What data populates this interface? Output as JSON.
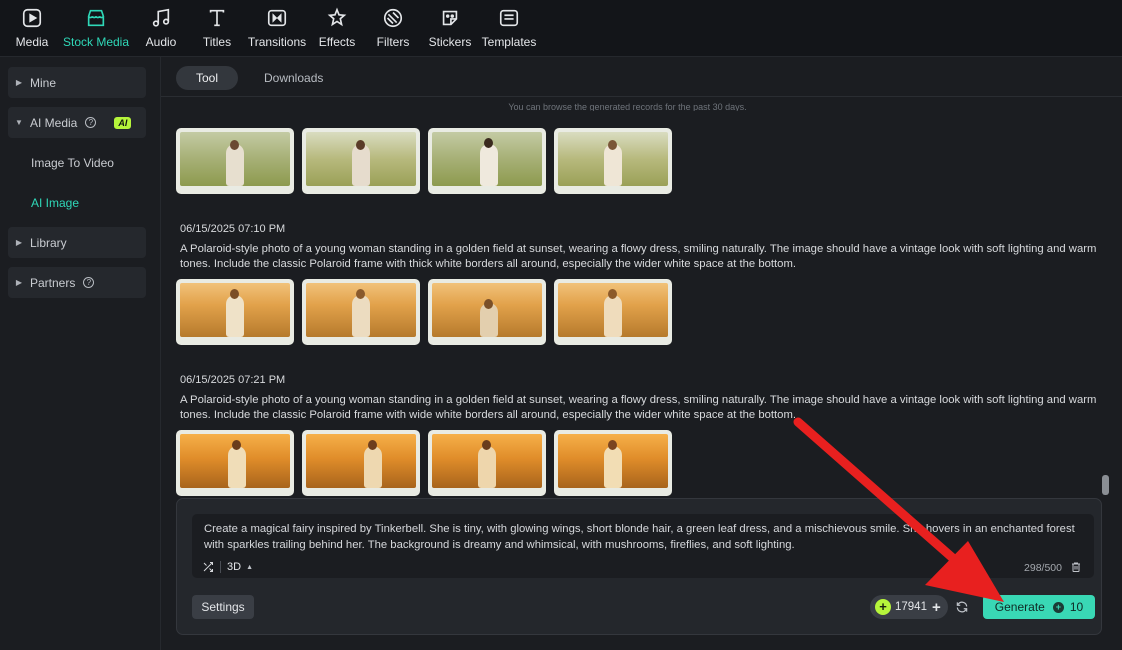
{
  "toolbar": {
    "items": [
      {
        "label": "Media",
        "icon": "media-icon"
      },
      {
        "label": "Stock Media",
        "icon": "stock-media-icon",
        "active": true
      },
      {
        "label": "Audio",
        "icon": "music-note-icon"
      },
      {
        "label": "Titles",
        "icon": "text-t-icon"
      },
      {
        "label": "Transitions",
        "icon": "transition-icon"
      },
      {
        "label": "Effects",
        "icon": "sparkle-icon"
      },
      {
        "label": "Filters",
        "icon": "filter-icon"
      },
      {
        "label": "Stickers",
        "icon": "sticker-icon"
      },
      {
        "label": "Templates",
        "icon": "template-icon"
      }
    ]
  },
  "sidebar": {
    "mine": "Mine",
    "ai_media": "AI Media",
    "ai_badge": "AI",
    "image_to_video": "Image To Video",
    "ai_image": "AI Image",
    "library": "Library",
    "partners": "Partners"
  },
  "tabs": {
    "tool": "Tool",
    "downloads": "Downloads"
  },
  "note": "You can browse the generated records for the past 30 days.",
  "records": [
    {
      "date": "06/15/2025 07:10 PM",
      "prompt": "A Polaroid-style photo of a young woman standing in a golden field at sunset, wearing a flowy dress, smiling naturally. The image should have a vintage look with soft lighting and warm tones. Include the classic Polaroid frame with thick white borders all around, especially the wider white space at the bottom."
    },
    {
      "date": "06/15/2025 07:21 PM",
      "prompt": "A Polaroid-style photo of a young woman standing in a golden field at sunset, wearing a flowy dress, smiling naturally. The image should have a vintage look with soft lighting and warm tones. Include the classic Polaroid frame with wide white borders all around, especially the wider white space at the bottom."
    }
  ],
  "generator": {
    "prompt": "Create a magical fairy inspired by Tinkerbell. She is tiny, with glowing wings, short blonde hair, a green leaf dress, and a mischievous smile. She hovers in an enchanted forest with sparkles trailing behind her. The background is dreamy and whimsical, with mushrooms, fireflies, and soft lighting.",
    "style": "3D",
    "counter": "298/500",
    "settings_label": "Settings",
    "credits": "17941",
    "generate_label": "Generate",
    "generate_cost": "10"
  },
  "colors": {
    "accent": "#39d8b5",
    "badge": "#b6f53b",
    "annotation_arrow": "#e8201f"
  }
}
